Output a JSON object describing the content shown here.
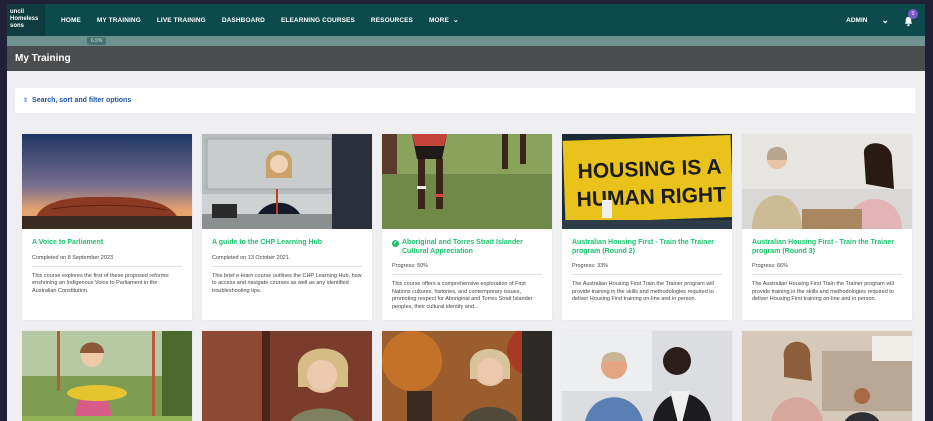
{
  "nav": {
    "logo_lines": [
      "uncil",
      "Homeless",
      "sons"
    ],
    "items": [
      {
        "label": "HOME"
      },
      {
        "label": "MY TRAINING"
      },
      {
        "label": "LIVE TRAINING"
      },
      {
        "label": "DASHBOARD"
      },
      {
        "label": "ELEARNING COURSES"
      },
      {
        "label": "RESOURCES"
      },
      {
        "label": "MORE",
        "has_dropdown": true
      }
    ],
    "user_label": "ADMIN",
    "notification_count": "0"
  },
  "progress": {
    "label": "6.5%"
  },
  "page": {
    "title": "My Training"
  },
  "filter": {
    "label": "Search, sort and filter options",
    "icon": "sort-arrows-icon"
  },
  "courses": [
    {
      "title": "A Voice to Parliament",
      "meta": "Completed on 8 September 2023",
      "description": "This course explores the first of these proposed reforms: enshrining an Indigenous Voice to Parliament in the Australian Constitution.",
      "completed_icon": false,
      "image": "uluru-landscape"
    },
    {
      "title": "A guide to the CHP Learning Hub",
      "meta": "Completed on 13 October 2021.",
      "description": "This brief e-learn course outlines the CHP Learning Hub, how to access and navigate courses as well as any identified troubleshooting tips.",
      "completed_icon": false,
      "image": "woman-at-desk"
    },
    {
      "title": "Aboriginal and Torres Strait Islander Cultural Appreciation",
      "meta": "Progress: 50%",
      "description": "This course offers a comprehensive exploration of First Nations cultures, histories, and contemporary issues, promoting respect for Aboriginal and Torres Strait Islander peoples, their cultural identity and...",
      "completed_icon": true,
      "image": "dancers-on-grass"
    },
    {
      "title": "Australian Housing First - Train the Trainer program (Round 2)",
      "meta": "Progress: 33%",
      "description": "The Australian Housing First Train the Trainer program will provide training in the skills and methodologies required to deliver Housing First training on-line and in person.",
      "completed_icon": false,
      "image": "housing-is-a-human-right-sign",
      "sign_text": [
        "HOUSING IS A",
        "HUMAN RIGHT"
      ]
    },
    {
      "title": "Australian Housing First - Train the Trainer program (Round 3)",
      "meta": "Progress: 66%",
      "description": "The Australian Housing First Train the Trainer program will provide training in the skills and methodologies required to deliver Housing First training on-line and in person.",
      "completed_icon": false,
      "image": "two-women-talking"
    },
    {
      "image": "child-on-swing"
    },
    {
      "image": "older-woman-brick-wall"
    },
    {
      "image": "older-woman-autumn-trees"
    },
    {
      "image": "man-in-conversation"
    },
    {
      "image": "woman-on-couch"
    }
  ],
  "colors": {
    "nav_bg": "#0c4a4e",
    "header_bg": "#4a4c4e",
    "title_green": "#1ac36b",
    "filter_blue": "#1c52a8"
  }
}
